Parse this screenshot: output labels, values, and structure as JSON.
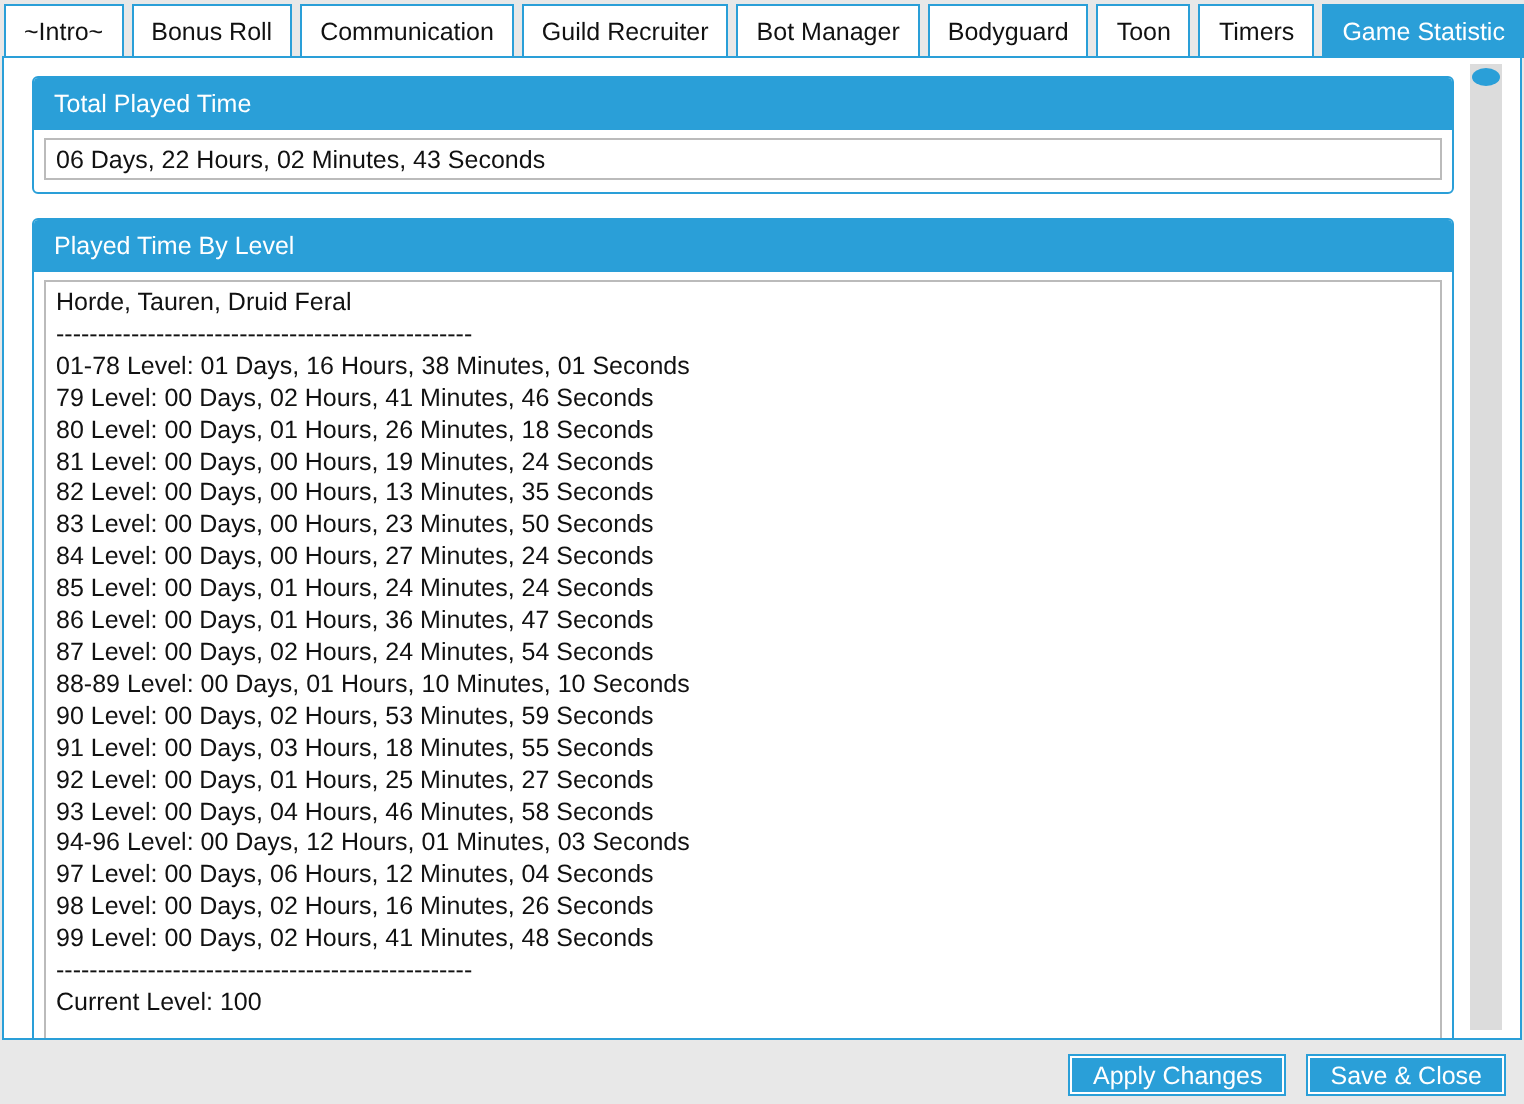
{
  "tabs": [
    {
      "label": "~Intro~",
      "selected": false
    },
    {
      "label": "Bonus Roll",
      "selected": false
    },
    {
      "label": "Communication",
      "selected": false
    },
    {
      "label": "Guild Recruiter",
      "selected": false
    },
    {
      "label": "Bot Manager",
      "selected": false
    },
    {
      "label": "Bodyguard",
      "selected": false
    },
    {
      "label": "Toon",
      "selected": false
    },
    {
      "label": "Timers",
      "selected": false
    },
    {
      "label": "Game Statistic",
      "selected": true
    }
  ],
  "total_played_time": {
    "title": "Total Played Time",
    "value": "06 Days, 22 Hours, 02 Minutes, 43 Seconds"
  },
  "played_time_by_level": {
    "title": "Played Time By Level",
    "lines": [
      "Horde, Tauren, Druid Feral",
      "--------------------------------------------------",
      "01-78 Level: 01 Days, 16 Hours, 38 Minutes, 01 Seconds",
      "79 Level: 00 Days, 02 Hours, 41 Minutes, 46 Seconds",
      "80 Level: 00 Days, 01 Hours, 26 Minutes, 18 Seconds",
      "81 Level: 00 Days, 00 Hours, 19 Minutes, 24 Seconds",
      "82 Level: 00 Days, 00 Hours, 13 Minutes, 35 Seconds",
      "83 Level: 00 Days, 00 Hours, 23 Minutes, 50 Seconds",
      "84 Level: 00 Days, 00 Hours, 27 Minutes, 24 Seconds",
      "85 Level: 00 Days, 01 Hours, 24 Minutes, 24 Seconds",
      "86 Level: 00 Days, 01 Hours, 36 Minutes, 47 Seconds",
      "87 Level: 00 Days, 02 Hours, 24 Minutes, 54 Seconds",
      "88-89 Level: 00 Days, 01 Hours, 10 Minutes, 10 Seconds",
      "90 Level: 00 Days, 02 Hours, 53 Minutes, 59 Seconds",
      "91 Level: 00 Days, 03 Hours, 18 Minutes, 55 Seconds",
      "92 Level: 00 Days, 01 Hours, 25 Minutes, 27 Seconds",
      "93 Level: 00 Days, 04 Hours, 46 Minutes, 58 Seconds",
      "94-96 Level: 00 Days, 12 Hours, 01 Minutes, 03 Seconds",
      "97 Level: 00 Days, 06 Hours, 12 Minutes, 04 Seconds",
      "98 Level: 00 Days, 02 Hours, 16 Minutes, 26 Seconds",
      "99 Level: 00 Days, 02 Hours, 41 Minutes, 48 Seconds",
      "--------------------------------------------------",
      "Current Level: 100"
    ]
  },
  "buttons": [
    "Apply Changes",
    "Save & Close"
  ]
}
